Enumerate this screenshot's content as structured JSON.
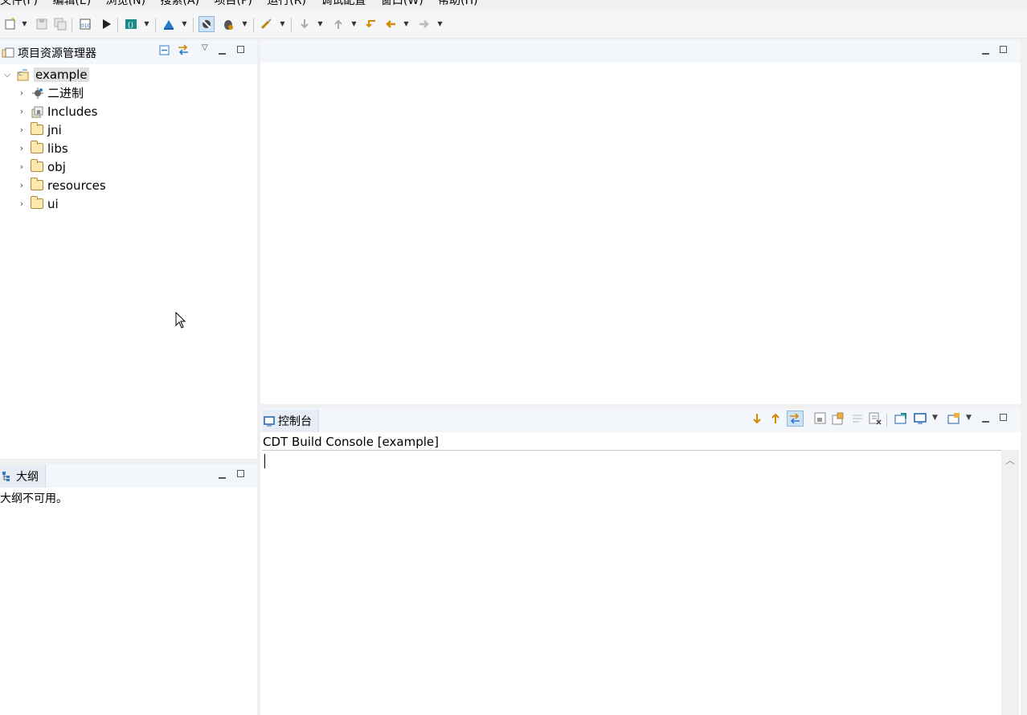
{
  "menubar": {
    "items": [
      "文件(F)",
      "编辑(E)",
      "浏览(N)",
      "搜索(A)",
      "项目(P)",
      "运行(R)",
      "调试配置",
      "窗口(W)",
      "帮助(H)"
    ]
  },
  "explorer": {
    "title": "项目资源管理器",
    "project": "example",
    "children": [
      {
        "label": "二进制",
        "icon": "binaries-icon"
      },
      {
        "label": "Includes",
        "icon": "includes-icon"
      },
      {
        "label": "jni",
        "icon": "folder-icon"
      },
      {
        "label": "libs",
        "icon": "folder-icon"
      },
      {
        "label": "obj",
        "icon": "folder-icon"
      },
      {
        "label": "resources",
        "icon": "folder-icon"
      },
      {
        "label": "ui",
        "icon": "folder-icon"
      }
    ]
  },
  "outline": {
    "title": "大纲",
    "message": "大纲不可用。"
  },
  "console": {
    "tab_label": "控制台",
    "title": "CDT Build Console [example]"
  },
  "colors": {
    "selection": "#e0e0e0",
    "header_bg": "#f3f6fb",
    "tab_bg": "#e7edf5",
    "toolbar_bg": "#f5f6f8"
  }
}
